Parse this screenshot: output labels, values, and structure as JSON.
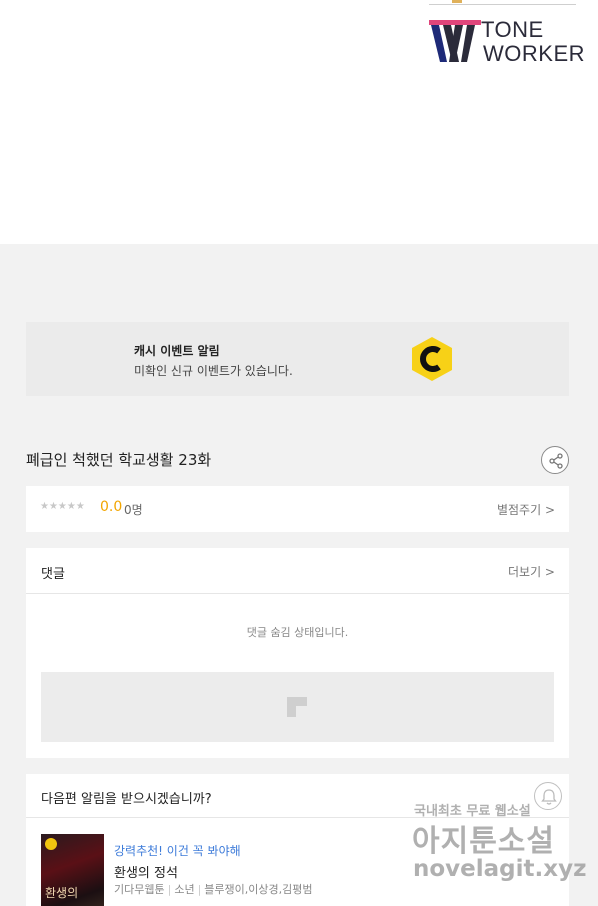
{
  "logo": {
    "line1": "TONE",
    "line2": "WORKER"
  },
  "cash_banner": {
    "title": "캐시 이벤트 알림",
    "subtitle": "미확인 신규 이벤트가 있습니다.",
    "icon": "c-coin-icon",
    "icon_color": "#f7d117"
  },
  "episode": {
    "title": "폐급인 척했던 학교생활 23화"
  },
  "rating": {
    "stars": "★★★★★",
    "score": "0.0",
    "count": "0명",
    "action": "별점주기 >"
  },
  "comments": {
    "title": "댓글",
    "more": "더보기 >",
    "notice": "댓글 숨김 상태입니다."
  },
  "next_notify": {
    "question": "다음편 알림을 받으시겠습니까?",
    "recommend_label": "강력추천! 이건 꼭 봐야해",
    "recommend_title": "환생의 정석",
    "thumb_text": "환생의",
    "meta": [
      "기다무웹툰",
      "소년",
      "블루쟁이,이상경,김평범"
    ]
  },
  "watermark": {
    "line1": "국내최초 무료 웹소설",
    "line2": "아지툰소설",
    "line3": "novelagit.xyz"
  },
  "colors": {
    "accent": "#f2a500",
    "link": "#3d7bd9"
  }
}
